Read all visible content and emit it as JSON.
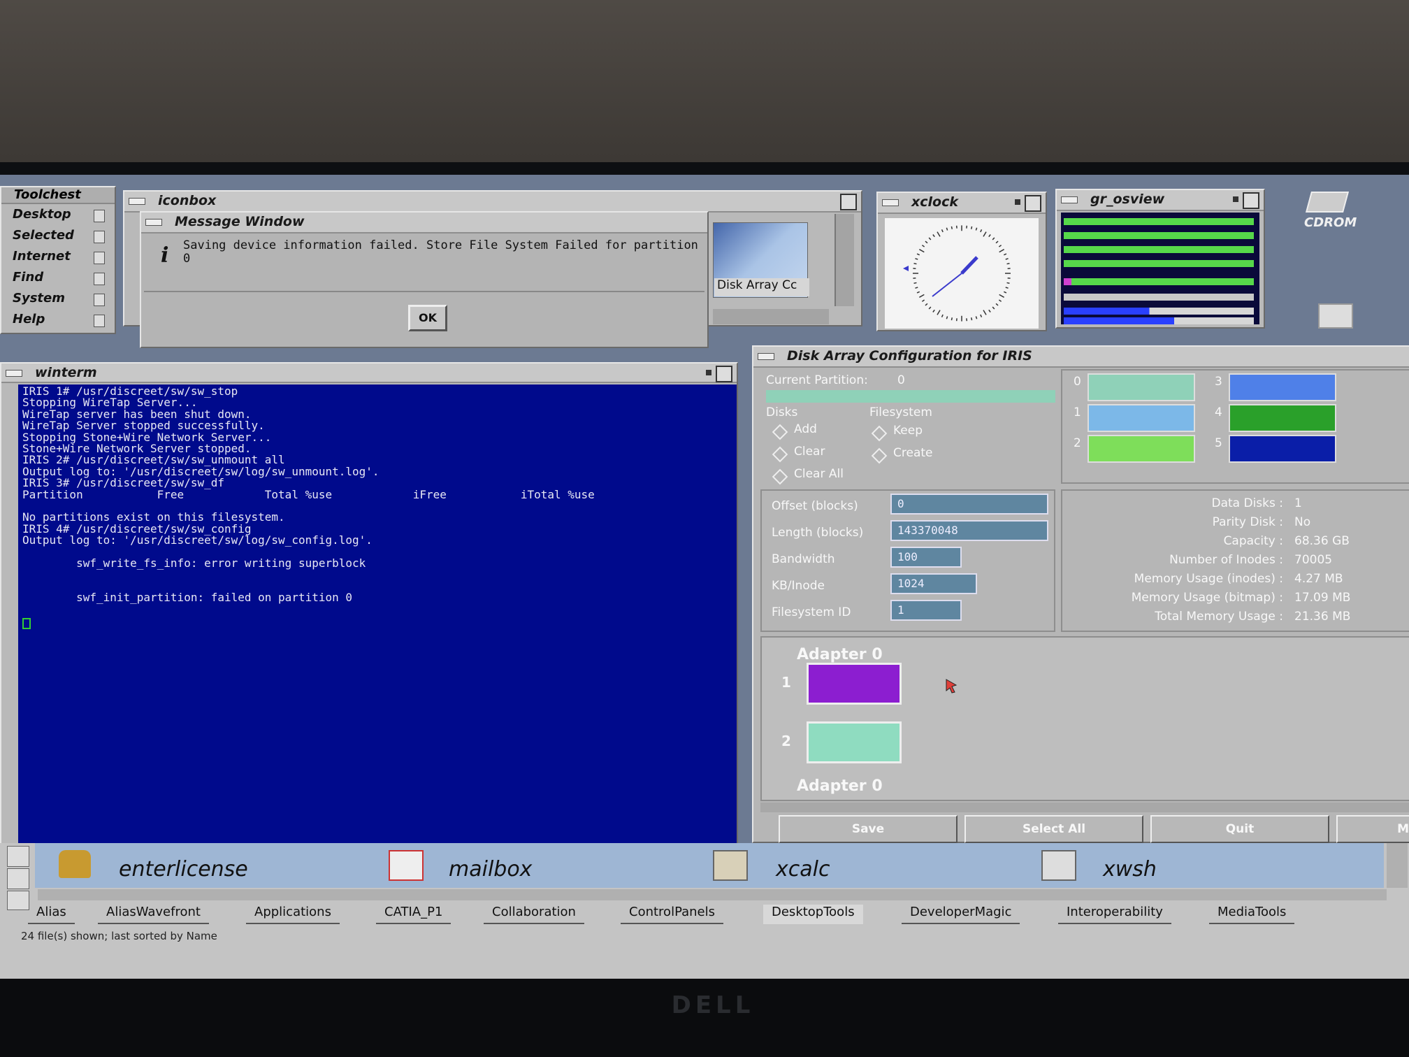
{
  "toolchest": {
    "title": "Toolchest",
    "items": [
      "Desktop",
      "Selected",
      "Internet",
      "Find",
      "System",
      "Help"
    ]
  },
  "iconbox": {
    "title": "iconbox",
    "thumb_label": "Disk Array Cc"
  },
  "message_window": {
    "title": "Message Window",
    "text_line1": "Saving device information failed.  Store File System Failed for partition",
    "text_line2": "0",
    "ok_label": "OK"
  },
  "xclock": {
    "title": "xclock"
  },
  "osview": {
    "title": "gr_osview"
  },
  "desktop": {
    "cdrom_label": "CDROM"
  },
  "winterm": {
    "title": "winterm",
    "lines": [
      "IRIS 1# /usr/discreet/sw/sw_stop",
      "Stopping WireTap Server...",
      "WireTap server has been shut down.",
      "WireTap Server stopped successfully.",
      "Stopping Stone+Wire Network Server...",
      "Stone+Wire Network Server stopped.",
      "IRIS 2# /usr/discreet/sw/sw_unmount all",
      "Output log to: '/usr/discreet/sw/log/sw_unmount.log'.",
      "IRIS 3# /usr/discreet/sw/sw_df",
      "Partition           Free            Total %use            iFree           iTotal %use",
      "",
      "No partitions exist on this filesystem.",
      "IRIS 4# /usr/discreet/sw/sw_config",
      "Output log to: '/usr/discreet/sw/log/sw_config.log'.",
      "",
      "        swf_write_fs_info: error writing superblock",
      "",
      "",
      "        swf_init_partition: failed on partition 0"
    ]
  },
  "disk_config": {
    "title": "Disk Array Configuration for IRIS",
    "current_partition_label": "Current Partition:",
    "current_partition_value": "0",
    "disks_label": "Disks",
    "filesystem_label": "Filesystem",
    "disks_options": [
      "Add",
      "Clear",
      "Clear All"
    ],
    "filesystem_options": [
      "Keep",
      "Create"
    ],
    "partitions": [
      {
        "num": "0",
        "color": "#8fd1b8"
      },
      {
        "num": "1",
        "color": "#7cb8e8"
      },
      {
        "num": "2",
        "color": "#7ede5a"
      },
      {
        "num": "3",
        "color": "#4f80e8"
      },
      {
        "num": "4",
        "color": "#2aa02a"
      },
      {
        "num": "5",
        "color": "#0a1ea8"
      }
    ],
    "fields": [
      {
        "label": "Offset (blocks)",
        "value": "0"
      },
      {
        "label": "Length (blocks)",
        "value": "143370048"
      },
      {
        "label": "Bandwidth",
        "value": "100"
      },
      {
        "label": "KB/Inode",
        "value": "1024"
      },
      {
        "label": "Filesystem ID",
        "value": "1"
      }
    ],
    "info": [
      {
        "label": "Data Disks :",
        "value": "1"
      },
      {
        "label": "Parity Disk :",
        "value": "No"
      },
      {
        "label": "Capacity :",
        "value": "68.36 GB"
      },
      {
        "label": "Number of Inodes :",
        "value": "70005"
      },
      {
        "label": "Memory Usage (inodes) :",
        "value": "4.27 MB"
      },
      {
        "label": "Memory Usage (bitmap) :",
        "value": "17.09 MB"
      },
      {
        "label": "Total Memory Usage    :",
        "value": "21.36 MB"
      }
    ],
    "adapter_title": "Adapter 0",
    "adapter_title_2": "Adapter 0",
    "adapter_disks": [
      {
        "num": "1",
        "color": "#8c1ed0"
      },
      {
        "num": "2",
        "color": "#8fdcc0"
      }
    ],
    "buttons": [
      "Save",
      "Select All",
      "Quit",
      "M"
    ]
  },
  "file_manager": {
    "apps": [
      "enterlicense",
      "mailbox",
      "xcalc",
      "xwsh"
    ],
    "tabs": [
      "Alias",
      "AliasWavefront",
      "Applications",
      "CATIA_P1",
      "Collaboration",
      "ControlPanels",
      "DesktopTools",
      "DeveloperMagic",
      "Interoperability",
      "MediaTools"
    ],
    "active_tab": "DesktopTools",
    "status": "24 file(s) shown; last sorted by Name"
  },
  "monitor": {
    "brand": "DELL"
  }
}
